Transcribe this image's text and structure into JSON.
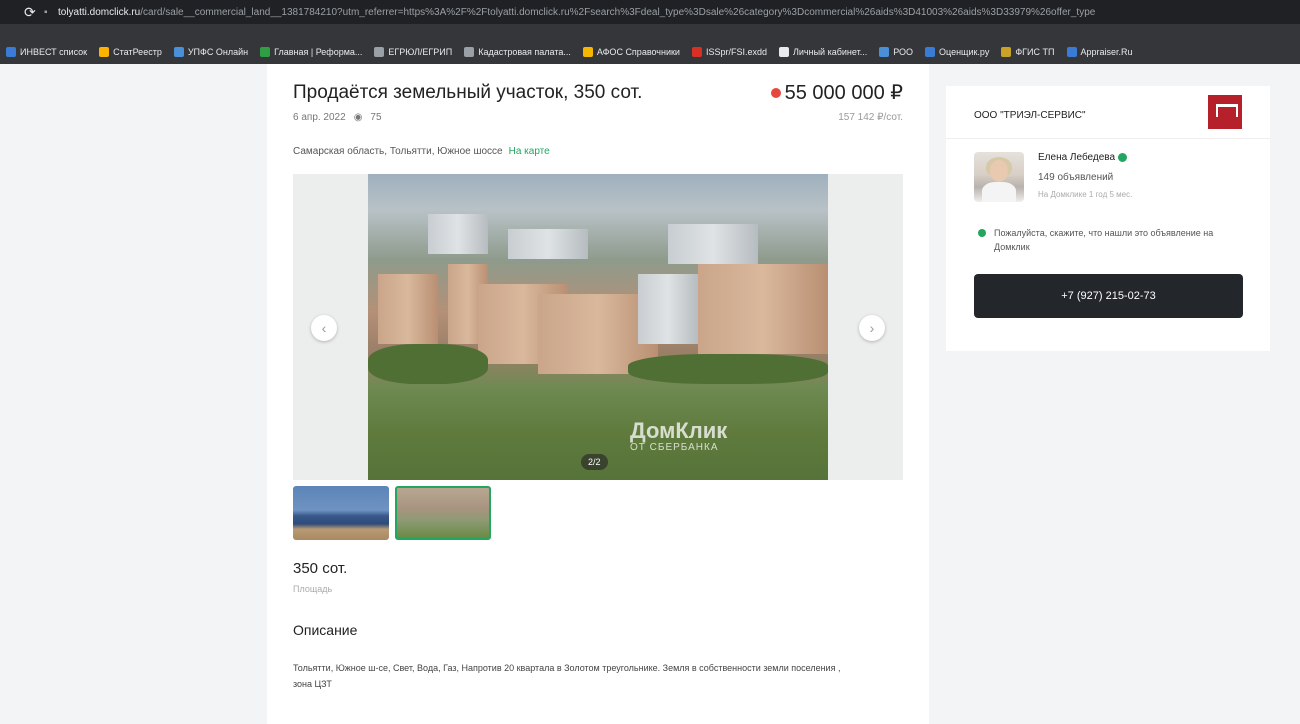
{
  "browser": {
    "url_domain": "tolyatti.domclick.ru",
    "url_path": "/card/sale__commercial_land__1381784210?utm_referrer=https%3A%2F%2Ftolyatti.domclick.ru%2Fsearch%3Fdeal_type%3Dsale%26category%3Dcommercial%26aids%3D41003%26aids%3D33979%26offer_type",
    "bookmarks": [
      "ИНВЕСТ список",
      "СтатРеестр",
      "УПФС Онлайн",
      "Главная | Реформа...",
      "ЕГРЮЛ/ЕГРИП",
      "Кадастровая палата...",
      "АФОС Справочники",
      "ISSpr/FSI.exdd",
      "Личный кабинет...",
      "РОО",
      "Оценщик.ру",
      "ФГИС ТП",
      "Appraiser.Ru"
    ],
    "bookmark_colors": [
      "#3a7bd5",
      "#ffb300",
      "#4a90d9",
      "#2ea043",
      "#9aa0a6",
      "#9aa0a6",
      "#f5b700",
      "#d93025",
      "#e8eaed",
      "#4a90d9",
      "#3a7bd5",
      "#c9a227",
      "#3a7bd5"
    ]
  },
  "listing": {
    "title": "Продаётся земельный участок, 350 сот.",
    "price": "55 000 000 ₽",
    "date": "6 апр. 2022",
    "views": "75",
    "price_per_unit": "157 142 ₽/сот.",
    "address": "Самарская область, Тольятти, Южное шоссе",
    "map_link": "На карте",
    "photo_counter": "2/2",
    "watermark_main": "ДомКлик",
    "watermark_sub": "ОТ СБЕРБАНКА",
    "area_value": "350 сот.",
    "area_label": "Площадь",
    "description_title": "Описание",
    "description": "Тольятти, Южное ш-се, Свет, Вода, Газ, Напротив 20 квартала в Золотом треугольнике. Земля в собственности земли поселения , зона ЦЗТ"
  },
  "seller": {
    "agency": "ООО \"ТРИЭЛ-СЕРВИС\"",
    "agent_name": "Елена Лебедева",
    "ads_count": "149 объявлений",
    "since": "На Домклике 1 год 5 мес.",
    "hint": "Пожалуйста, скажите, что нашли это объявление на Домклик",
    "phone": "+7 (927) 215-02-73"
  },
  "colors": {
    "accent_green": "#22a660",
    "price_dot": "#e5483c",
    "phone_button": "#23262b",
    "agency_logo": "#b5202b"
  }
}
